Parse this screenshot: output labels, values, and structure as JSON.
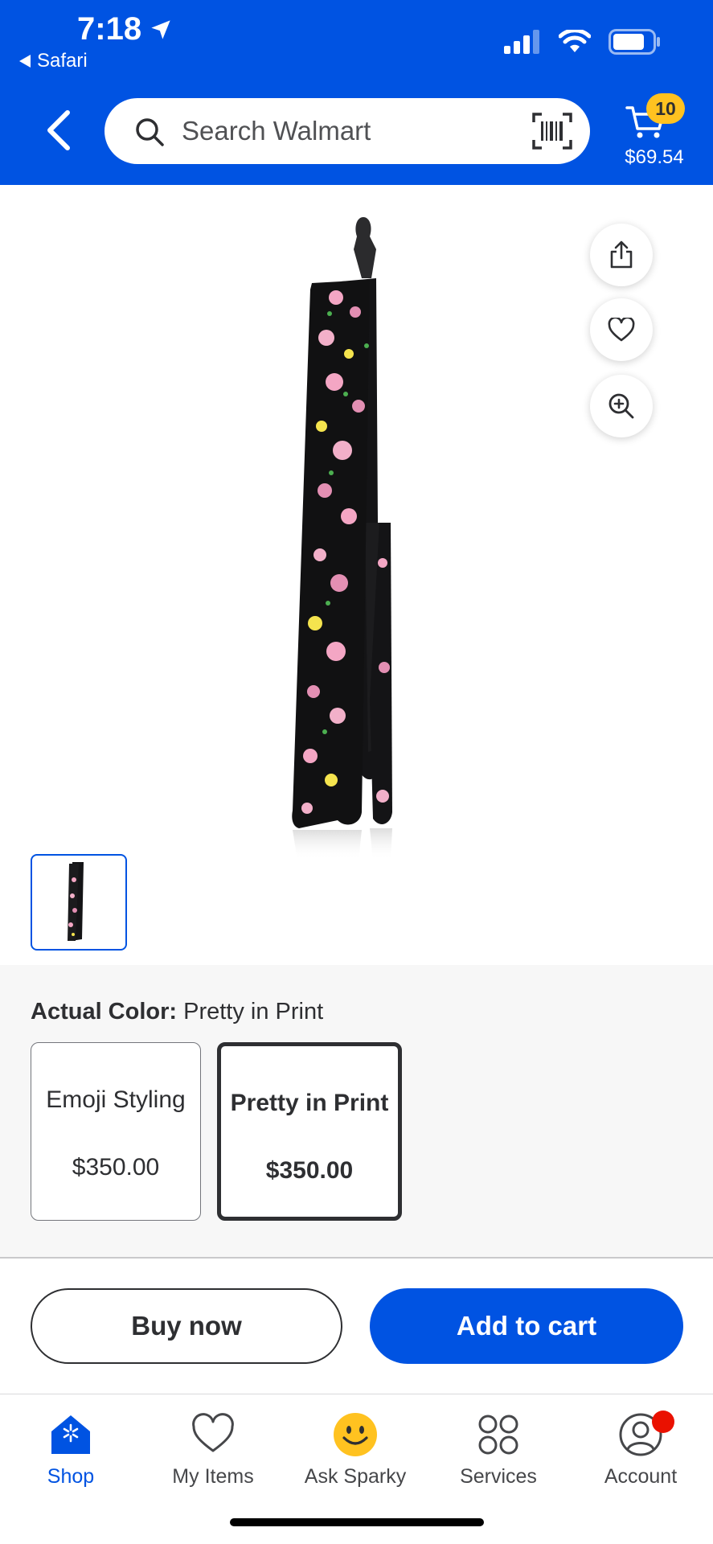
{
  "status_bar": {
    "time": "7:18",
    "back_app": "Safari"
  },
  "header": {
    "search": {
      "placeholder": "Search Walmart"
    },
    "cart": {
      "count": "10",
      "total": "$69.54"
    }
  },
  "product": {
    "image_icon": "floral-flat-iron",
    "actions": [
      "share-icon",
      "heart-icon",
      "zoom-in-icon"
    ]
  },
  "variants": {
    "label_prefix": "Actual Color:",
    "selected_value": "Pretty in Print",
    "options": [
      {
        "name": "Emoji Styling",
        "price": "$350.00",
        "selected": false
      },
      {
        "name": "Pretty in Print",
        "price": "$350.00",
        "selected": true
      }
    ]
  },
  "actions": {
    "buy_now": "Buy now",
    "add_to_cart": "Add to cart"
  },
  "bottom_nav": {
    "items": [
      {
        "label": "Shop",
        "icon": "shop-icon",
        "active": true
      },
      {
        "label": "My Items",
        "icon": "heart-icon",
        "active": false
      },
      {
        "label": "Ask Sparky",
        "icon": "smiley-icon",
        "active": false
      },
      {
        "label": "Services",
        "icon": "services-icon",
        "active": false
      },
      {
        "label": "Account",
        "icon": "account-icon",
        "active": false,
        "notification_dot": true
      }
    ]
  },
  "colors": {
    "brand_blue": "#0053e2",
    "spark_yellow": "#ffc220",
    "notification_red": "#ea1100"
  }
}
